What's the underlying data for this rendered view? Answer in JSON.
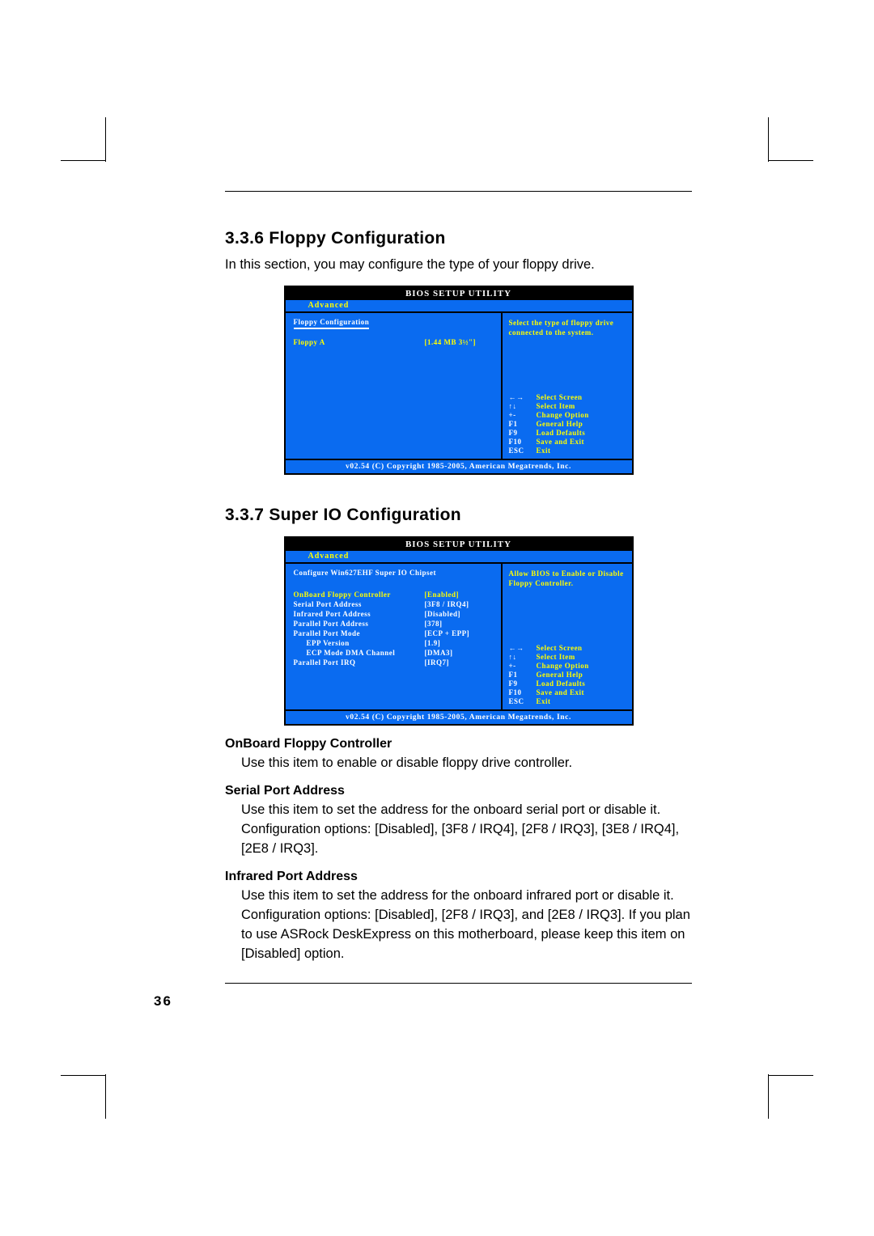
{
  "page_number": "36",
  "section336": {
    "heading": "3.3.6 Floppy Configuration",
    "intro": "In this section, you may configure the type of your floppy drive."
  },
  "section337": {
    "heading": "3.3.7 Super IO Configuration"
  },
  "bios": {
    "title": "BIOS SETUP UTILITY",
    "tab": "Advanced",
    "footer": "v02.54 (C) Copyright 1985-2005, American Megatrends, Inc.",
    "keys": [
      {
        "k": "←→",
        "d": "Select Screen"
      },
      {
        "k": "↑↓",
        "d": "Select Item"
      },
      {
        "k": "+-",
        "d": "Change Option"
      },
      {
        "k": "F1",
        "d": "General Help"
      },
      {
        "k": "F9",
        "d": "Load Defaults"
      },
      {
        "k": "F10",
        "d": "Save and Exit"
      },
      {
        "k": "ESC",
        "d": "Exit"
      }
    ],
    "floppy": {
      "panel_title": "Floppy Configuration",
      "help": "Select the type of floppy drive connected to the system.",
      "items": [
        {
          "label": "Floppy A",
          "value": "[1.44 MB 3½\"]"
        }
      ]
    },
    "superio": {
      "panel_title": "Configure Win627EHF Super IO Chipset",
      "help": "Allow BIOS to Enable or Disable Floppy Controller.",
      "items": [
        {
          "label": "OnBoard Floppy Controller",
          "value": "[Enabled]"
        },
        {
          "label": "Serial Port Address",
          "value": "[3F8 / IRQ4]"
        },
        {
          "label": "Infrared Port Address",
          "value": "[Disabled]"
        },
        {
          "label": "Parallel Port Address",
          "value": "[378]"
        },
        {
          "label": "Parallel Port Mode",
          "value": "[ECP + EPP]"
        },
        {
          "label": "EPP Version",
          "value": "[1.9]"
        },
        {
          "label": "ECP Mode DMA Channel",
          "value": "[DMA3]"
        },
        {
          "label": "Parallel Port IRQ",
          "value": "[IRQ7]"
        }
      ]
    }
  },
  "descriptions": [
    {
      "title": "OnBoard Floppy Controller",
      "text": "Use this item to enable or disable floppy drive controller."
    },
    {
      "title": "Serial Port Address",
      "text": "Use this item to set the address for the onboard serial port or disable it. Configuration options: [Disabled], [3F8 / IRQ4], [2F8 / IRQ3], [3E8 / IRQ4], [2E8 / IRQ3]."
    },
    {
      "title": "Infrared Port Address",
      "text": "Use this item to set the address for the onboard infrared port or disable it. Configuration options: [Disabled], [2F8 / IRQ3], and [2E8 / IRQ3]. If you plan to use ASRock DeskExpress on this motherboard, please keep this item on [Disabled] option."
    }
  ]
}
